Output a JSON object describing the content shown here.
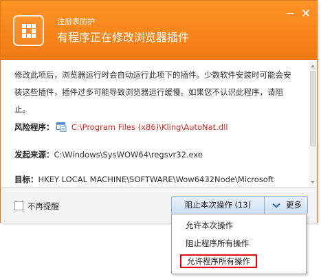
{
  "dialog": {
    "subtitle": "注册表防护",
    "title": "有程序正在修改浏览器插件",
    "logo_icon": "grid-shield-icon"
  },
  "content": {
    "intro": "修改此项后，浏览器运行时会自动运行此项下的插件。少数软件安装时可能会安装这些插件，插件过多可能导致浏览器运行缓慢。如果您不认识此程序，请阻止。",
    "risk_label": "风险程序：",
    "risk_path": "C:\\Program Files (x86)\\Kling\\AutoNat.dll",
    "origin_label": "发起来源：",
    "origin_path": "C:\\Windows\\SysWOW64\\regsvr32.exe",
    "target_label": "目标：",
    "target_path": "HKEY LOCAL MACHINE\\SOFTWARE\\Wow6432Node\\Microsoft"
  },
  "footer": {
    "no_remind": "不再提醒",
    "block_button": "阻止本次操作 (13)",
    "more_button": "更多"
  },
  "menu": {
    "items": [
      "允许本次操作",
      "阻止程序所有操作",
      "允许程序所有操作"
    ]
  },
  "colors": {
    "header": "#f58a1f",
    "risk_path": "#d42a1e",
    "highlight_border": "#e60012"
  }
}
